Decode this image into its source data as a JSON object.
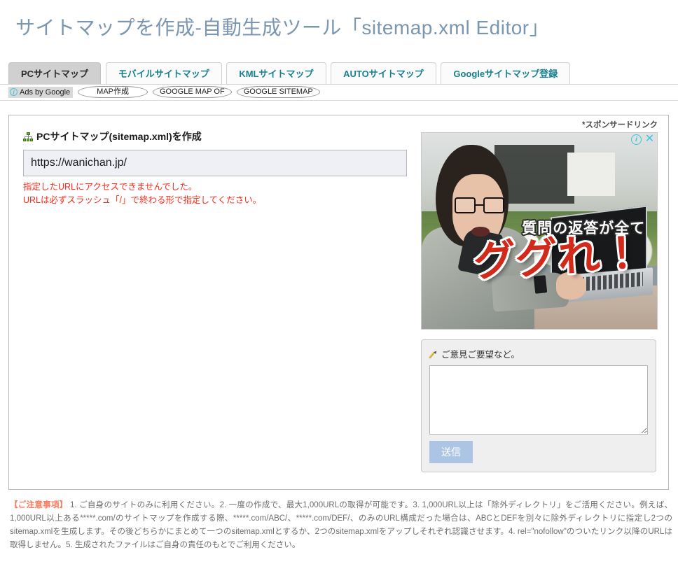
{
  "page": {
    "title": "サイトマップを作成-自動生成ツール「sitemap.xml Editor」"
  },
  "tabs": [
    {
      "label": "PCサイトマップ",
      "active": true
    },
    {
      "label": "モバイルサイトマップ",
      "active": false
    },
    {
      "label": "KMLサイトマップ",
      "active": false
    },
    {
      "label": "AUTOサイトマップ",
      "active": false
    },
    {
      "label": "Googleサイトマップ登録",
      "active": false
    }
  ],
  "ads_strip": {
    "label": "Ads by Google",
    "info_glyph": "i",
    "chips": [
      "MAP作成",
      "GOOGLE MAP OF",
      "GOOGLE SITEMAP"
    ]
  },
  "main": {
    "section_title": "PCサイトマップ(sitemap.xml)を作成",
    "url_input": {
      "value": "https://wanichan.jp/",
      "placeholder": ""
    },
    "errors": [
      "指定したURLにアクセスできませんでした。",
      "URLは必ずスラッシュ「/」で終わる形で指定してください。"
    ]
  },
  "ad": {
    "sponsor_label": "*スポンサードリンク",
    "info_glyph": "i",
    "close_glyph": "✕",
    "creative_line1": "質問の返答が全て",
    "creative_line2": "ググれ！"
  },
  "feedback": {
    "title": "ご意見ご要望など。",
    "textarea_value": "",
    "textarea_placeholder": "",
    "submit_label": "送信"
  },
  "footer": {
    "warn_label": "【ご注意事項】",
    "body": " 1. ご自身のサイトのみに利用ください。2. 一度の作成で、最大1,000URLの取得が可能です。3. 1,000URL以上は「除外ディレクトリ」をご活用ください。例えば、1,000URL以上ある*****.com/のサイトマップを作成する際、*****.com/ABC/、*****.com/DEF/、のみのURL構成だった場合は、ABCとDEFを別々に除外ディレクトリに指定し2つのsitemap.xmlを生成します。その後どちらかにまとめて一つのsitemap.xmlとするか、2つのsitemap.xmlをアップしそれぞれ認識させます。4. rel=\"nofollow\"のついたリンク以降のURLは取得しません。5. 生成されたファイルはご自身の責任のもとでご利用ください。"
  },
  "colors": {
    "title": "#7b96b0",
    "tab_text": "#17808f",
    "tab_active_bg": "#d0d0d0",
    "error": "#ff2a1a",
    "submit_bg": "#adc5e5",
    "footer_warn": "#ff7a5c",
    "sitemap_icon": "#6fae2f"
  }
}
